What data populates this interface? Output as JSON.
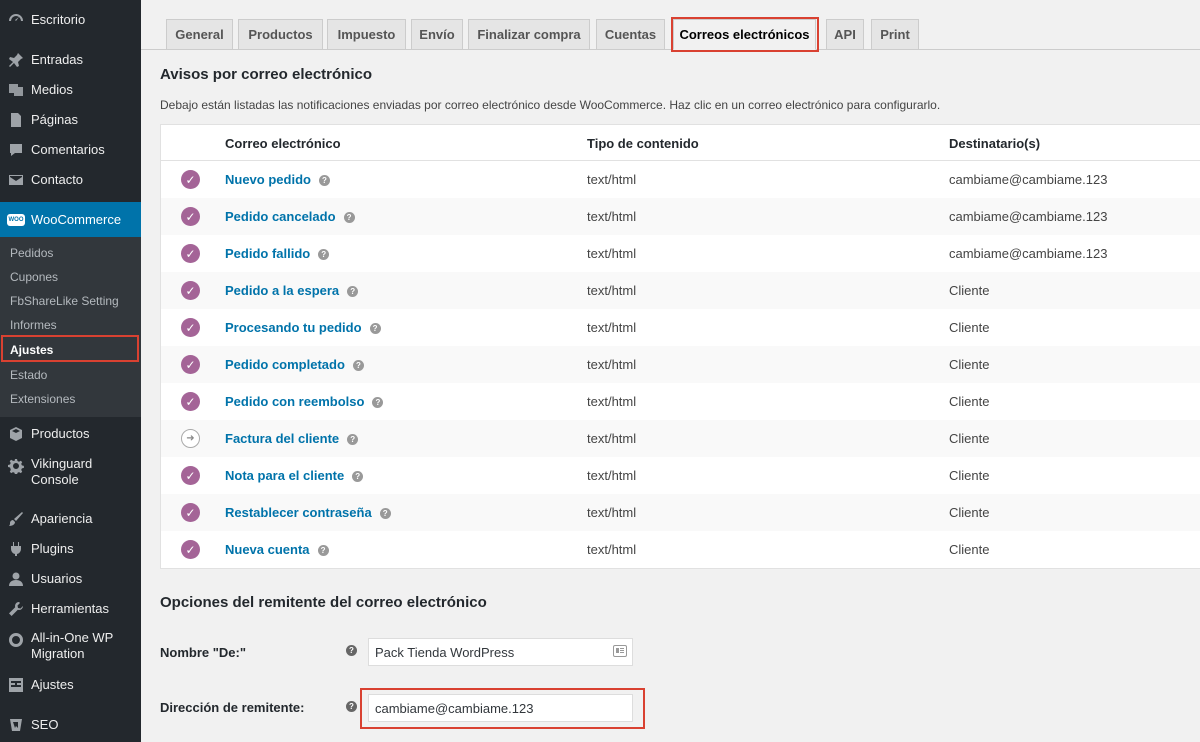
{
  "sidebar": {
    "top_items": [
      {
        "label": "Escritorio",
        "icon": "dashboard-icon"
      },
      {
        "label": "Entradas",
        "icon": "pin-icon"
      },
      {
        "label": "Medios",
        "icon": "media-icon"
      },
      {
        "label": "Páginas",
        "icon": "pages-icon"
      },
      {
        "label": "Comentarios",
        "icon": "comment-icon"
      },
      {
        "label": "Contacto",
        "icon": "mail-icon"
      },
      {
        "label": "WooCommerce",
        "icon": "woocommerce-icon"
      }
    ],
    "submenu": [
      "Pedidos",
      "Cupones",
      "FbShareLike Setting",
      "Informes",
      "Ajustes",
      "Estado",
      "Extensiones"
    ],
    "bottom_items": [
      {
        "label": "Productos",
        "icon": "box-icon"
      },
      {
        "label": "Vikinguard Console",
        "icon": "gear-icon"
      },
      {
        "label": "Apariencia",
        "icon": "brush-icon"
      },
      {
        "label": "Plugins",
        "icon": "plugin-icon"
      },
      {
        "label": "Usuarios",
        "icon": "user-icon"
      },
      {
        "label": "Herramientas",
        "icon": "wrench-icon"
      },
      {
        "label": "All-in-One WP Migration",
        "icon": "migration-icon"
      },
      {
        "label": "Ajustes",
        "icon": "settings-icon"
      },
      {
        "label": "SEO",
        "icon": "seo-icon"
      }
    ]
  },
  "tabs": [
    "General",
    "Productos",
    "Impuesto",
    "Envío",
    "Finalizar compra",
    "Cuentas",
    "Correos electrónicos",
    "API",
    "Print"
  ],
  "active_tab": "Correos electrónicos",
  "notifications": {
    "heading": "Avisos por correo electrónico",
    "description": "Debajo están listadas las notificaciones enviadas por correo electrónico desde WooCommerce. Haz clic en un correo electrónico para configurarlo.",
    "columns": [
      "Correo electrónico",
      "Tipo de contenido",
      "Destinatario(s)"
    ],
    "rows": [
      {
        "name": "Nuevo pedido",
        "type": "text/html",
        "recipient": "cambiame@cambiame.123",
        "enabled": true
      },
      {
        "name": "Pedido cancelado",
        "type": "text/html",
        "recipient": "cambiame@cambiame.123",
        "enabled": true
      },
      {
        "name": "Pedido fallido",
        "type": "text/html",
        "recipient": "cambiame@cambiame.123",
        "enabled": true
      },
      {
        "name": "Pedido a la espera",
        "type": "text/html",
        "recipient": "Cliente",
        "enabled": true
      },
      {
        "name": "Procesando tu pedido",
        "type": "text/html",
        "recipient": "Cliente",
        "enabled": true
      },
      {
        "name": "Pedido completado",
        "type": "text/html",
        "recipient": "Cliente",
        "enabled": true
      },
      {
        "name": "Pedido con reembolso",
        "type": "text/html",
        "recipient": "Cliente",
        "enabled": true
      },
      {
        "name": "Factura del cliente",
        "type": "text/html",
        "recipient": "Cliente",
        "enabled": false
      },
      {
        "name": "Nota para el cliente",
        "type": "text/html",
        "recipient": "Cliente",
        "enabled": true
      },
      {
        "name": "Restablecer contraseña",
        "type": "text/html",
        "recipient": "Cliente",
        "enabled": true
      },
      {
        "name": "Nueva cuenta",
        "type": "text/html",
        "recipient": "Cliente",
        "enabled": true
      }
    ]
  },
  "sender": {
    "heading": "Opciones del remitente del correo electrónico",
    "from_name_label": "Nombre \"De:\"",
    "from_name_value": "Pack Tienda WordPress",
    "from_address_label": "Dirección de remitente:",
    "from_address_value": "cambiame@cambiame.123"
  },
  "colors": {
    "accent": "#0073aa",
    "woo_purple": "#a46497",
    "highlight_red": "#d94131",
    "sidebar_bg": "#23282d"
  }
}
